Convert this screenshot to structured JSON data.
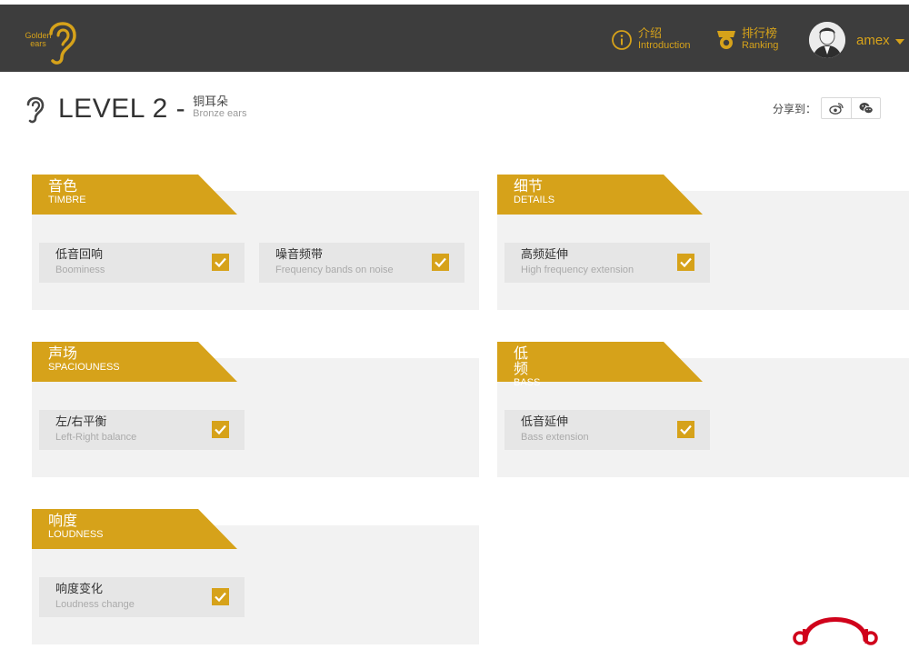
{
  "header": {
    "logo_text": "Golden ears",
    "nav": [
      {
        "cn": "介绍",
        "en": "Introduction",
        "icon": "info-icon"
      },
      {
        "cn": "排行榜",
        "en": "Ranking",
        "icon": "medal-icon"
      }
    ],
    "user": {
      "name": "amex"
    }
  },
  "level": {
    "title": "LEVEL 2 -",
    "sub_cn": "铜耳朵",
    "sub_en": "Bronze ears"
  },
  "share": {
    "label": "分享到：",
    "buttons": [
      "weibo-icon",
      "wechat-icon"
    ]
  },
  "categories": [
    {
      "cn": "音色",
      "en": "TIMBRE",
      "items": [
        {
          "cn": "低音回响",
          "en": "Boominess",
          "checked": true
        },
        {
          "cn": "噪音频带",
          "en": "Frequency bands on noise",
          "checked": true
        }
      ]
    },
    {
      "cn": "细节",
      "en": "DETAILS",
      "items": [
        {
          "cn": "高频延伸",
          "en": "High frequency extension",
          "checked": true
        }
      ]
    },
    {
      "cn": "声场",
      "en": "SPACIOUNESS",
      "items": [
        {
          "cn": "左/右平衡",
          "en": "Left-Right balance",
          "checked": true
        }
      ]
    },
    {
      "cn": "低频",
      "en": "BASS",
      "items": [
        {
          "cn": "低音延伸",
          "en": "Bass extension",
          "checked": true
        }
      ]
    },
    {
      "cn": "响度",
      "en": "LOUDNESS",
      "items": [
        {
          "cn": "响度变化",
          "en": "Loudness change",
          "checked": true
        }
      ]
    }
  ],
  "colors": {
    "accent": "#d6a21a",
    "navbar": "#3d3d3d",
    "panel": "#f2f2f2",
    "item": "#e6e6e6",
    "brand_red": "#d0021b"
  }
}
